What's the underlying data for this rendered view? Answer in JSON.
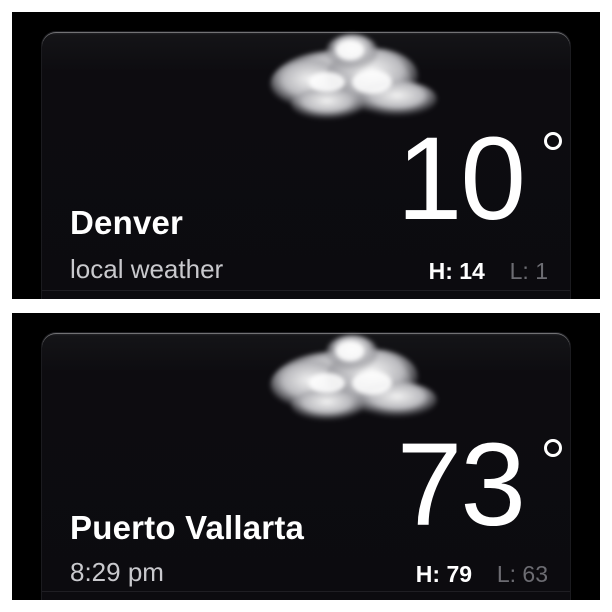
{
  "cards": [
    {
      "city": "Denver",
      "subtitle": "local weather",
      "temperature": "10",
      "high_label": "H:",
      "high": "14",
      "low_label": "L:",
      "low": "1",
      "condition_icon": "cloud-icon"
    },
    {
      "city": "Puerto Vallarta",
      "subtitle": "8:29 pm",
      "temperature": "73",
      "high_label": "H:",
      "high": "79",
      "low_label": "L:",
      "low": "63",
      "condition_icon": "cloud-icon"
    }
  ],
  "colors": {
    "background": "#000000",
    "card": "#0c0b0f",
    "text": "#ffffff",
    "muted": "#6c6c72",
    "border": "#ffffff"
  }
}
